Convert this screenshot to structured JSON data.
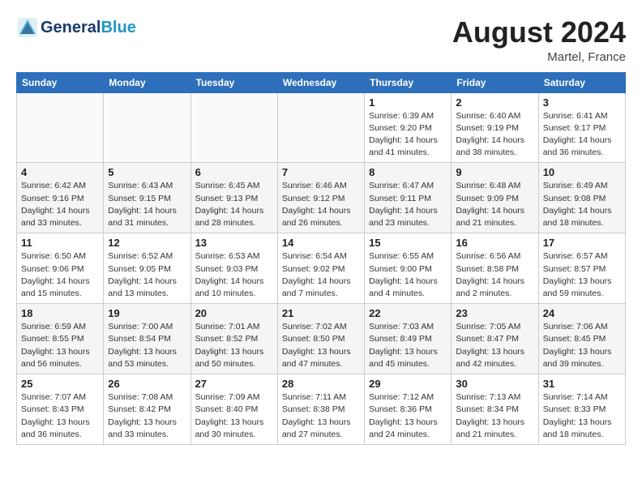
{
  "header": {
    "logo_general": "General",
    "logo_blue": "Blue",
    "title": "August 2024",
    "location": "Martel, France"
  },
  "days_of_week": [
    "Sunday",
    "Monday",
    "Tuesday",
    "Wednesday",
    "Thursday",
    "Friday",
    "Saturday"
  ],
  "weeks": [
    {
      "days": [
        {
          "num": "",
          "info": ""
        },
        {
          "num": "",
          "info": ""
        },
        {
          "num": "",
          "info": ""
        },
        {
          "num": "",
          "info": ""
        },
        {
          "num": "1",
          "info": "Sunrise: 6:39 AM\nSunset: 9:20 PM\nDaylight: 14 hours\nand 41 minutes."
        },
        {
          "num": "2",
          "info": "Sunrise: 6:40 AM\nSunset: 9:19 PM\nDaylight: 14 hours\nand 38 minutes."
        },
        {
          "num": "3",
          "info": "Sunrise: 6:41 AM\nSunset: 9:17 PM\nDaylight: 14 hours\nand 36 minutes."
        }
      ]
    },
    {
      "days": [
        {
          "num": "4",
          "info": "Sunrise: 6:42 AM\nSunset: 9:16 PM\nDaylight: 14 hours\nand 33 minutes."
        },
        {
          "num": "5",
          "info": "Sunrise: 6:43 AM\nSunset: 9:15 PM\nDaylight: 14 hours\nand 31 minutes."
        },
        {
          "num": "6",
          "info": "Sunrise: 6:45 AM\nSunset: 9:13 PM\nDaylight: 14 hours\nand 28 minutes."
        },
        {
          "num": "7",
          "info": "Sunrise: 6:46 AM\nSunset: 9:12 PM\nDaylight: 14 hours\nand 26 minutes."
        },
        {
          "num": "8",
          "info": "Sunrise: 6:47 AM\nSunset: 9:11 PM\nDaylight: 14 hours\nand 23 minutes."
        },
        {
          "num": "9",
          "info": "Sunrise: 6:48 AM\nSunset: 9:09 PM\nDaylight: 14 hours\nand 21 minutes."
        },
        {
          "num": "10",
          "info": "Sunrise: 6:49 AM\nSunset: 9:08 PM\nDaylight: 14 hours\nand 18 minutes."
        }
      ]
    },
    {
      "days": [
        {
          "num": "11",
          "info": "Sunrise: 6:50 AM\nSunset: 9:06 PM\nDaylight: 14 hours\nand 15 minutes."
        },
        {
          "num": "12",
          "info": "Sunrise: 6:52 AM\nSunset: 9:05 PM\nDaylight: 14 hours\nand 13 minutes."
        },
        {
          "num": "13",
          "info": "Sunrise: 6:53 AM\nSunset: 9:03 PM\nDaylight: 14 hours\nand 10 minutes."
        },
        {
          "num": "14",
          "info": "Sunrise: 6:54 AM\nSunset: 9:02 PM\nDaylight: 14 hours\nand 7 minutes."
        },
        {
          "num": "15",
          "info": "Sunrise: 6:55 AM\nSunset: 9:00 PM\nDaylight: 14 hours\nand 4 minutes."
        },
        {
          "num": "16",
          "info": "Sunrise: 6:56 AM\nSunset: 8:58 PM\nDaylight: 14 hours\nand 2 minutes."
        },
        {
          "num": "17",
          "info": "Sunrise: 6:57 AM\nSunset: 8:57 PM\nDaylight: 13 hours\nand 59 minutes."
        }
      ]
    },
    {
      "days": [
        {
          "num": "18",
          "info": "Sunrise: 6:59 AM\nSunset: 8:55 PM\nDaylight: 13 hours\nand 56 minutes."
        },
        {
          "num": "19",
          "info": "Sunrise: 7:00 AM\nSunset: 8:54 PM\nDaylight: 13 hours\nand 53 minutes."
        },
        {
          "num": "20",
          "info": "Sunrise: 7:01 AM\nSunset: 8:52 PM\nDaylight: 13 hours\nand 50 minutes."
        },
        {
          "num": "21",
          "info": "Sunrise: 7:02 AM\nSunset: 8:50 PM\nDaylight: 13 hours\nand 47 minutes."
        },
        {
          "num": "22",
          "info": "Sunrise: 7:03 AM\nSunset: 8:49 PM\nDaylight: 13 hours\nand 45 minutes."
        },
        {
          "num": "23",
          "info": "Sunrise: 7:05 AM\nSunset: 8:47 PM\nDaylight: 13 hours\nand 42 minutes."
        },
        {
          "num": "24",
          "info": "Sunrise: 7:06 AM\nSunset: 8:45 PM\nDaylight: 13 hours\nand 39 minutes."
        }
      ]
    },
    {
      "days": [
        {
          "num": "25",
          "info": "Sunrise: 7:07 AM\nSunset: 8:43 PM\nDaylight: 13 hours\nand 36 minutes."
        },
        {
          "num": "26",
          "info": "Sunrise: 7:08 AM\nSunset: 8:42 PM\nDaylight: 13 hours\nand 33 minutes."
        },
        {
          "num": "27",
          "info": "Sunrise: 7:09 AM\nSunset: 8:40 PM\nDaylight: 13 hours\nand 30 minutes."
        },
        {
          "num": "28",
          "info": "Sunrise: 7:11 AM\nSunset: 8:38 PM\nDaylight: 13 hours\nand 27 minutes."
        },
        {
          "num": "29",
          "info": "Sunrise: 7:12 AM\nSunset: 8:36 PM\nDaylight: 13 hours\nand 24 minutes."
        },
        {
          "num": "30",
          "info": "Sunrise: 7:13 AM\nSunset: 8:34 PM\nDaylight: 13 hours\nand 21 minutes."
        },
        {
          "num": "31",
          "info": "Sunrise: 7:14 AM\nSunset: 8:33 PM\nDaylight: 13 hours\nand 18 minutes."
        }
      ]
    }
  ]
}
